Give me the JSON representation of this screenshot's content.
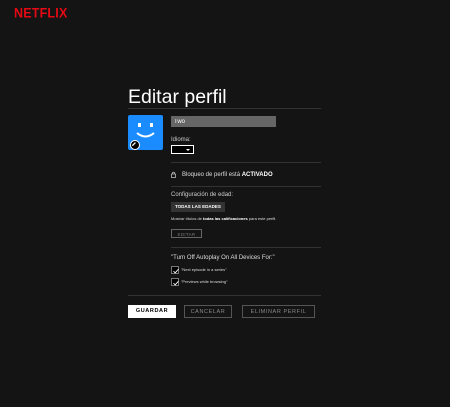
{
  "brand": {
    "logo_text": "NETFLIX",
    "color": "#e50914"
  },
  "page": {
    "title": "Editar perfil"
  },
  "profile": {
    "avatar_color": "#1a8cff",
    "name_value": "Two",
    "language_label": "Idioma:",
    "language_value": ""
  },
  "lock": {
    "prefix": "Bloqueo de perfil está ",
    "status": "ACTIVADO"
  },
  "maturity": {
    "label": "Configuración de edad:",
    "tag": "TODAS LAS EDADES",
    "desc_prefix": "Mostrar títulos de ",
    "desc_bold": "todas las calificaciones",
    "desc_suffix": " para este perfil.",
    "edit_button": "EDITAR"
  },
  "autoplay": {
    "title": "\"Turn Off Autoplay On All Devices For:\"",
    "options": [
      {
        "label": "\"Next episode in a series\"",
        "checked": true
      },
      {
        "label": "\"Previews while browsing\"",
        "checked": true
      }
    ]
  },
  "actions": {
    "save": "GUARDAR",
    "cancel": "CANCELAR",
    "delete": "ELIMINAR PERFIL"
  },
  "icons": {
    "lock": "lock-icon",
    "edit": "pencil-icon",
    "check": "checkmark-icon",
    "caret": "caret-down-icon"
  }
}
